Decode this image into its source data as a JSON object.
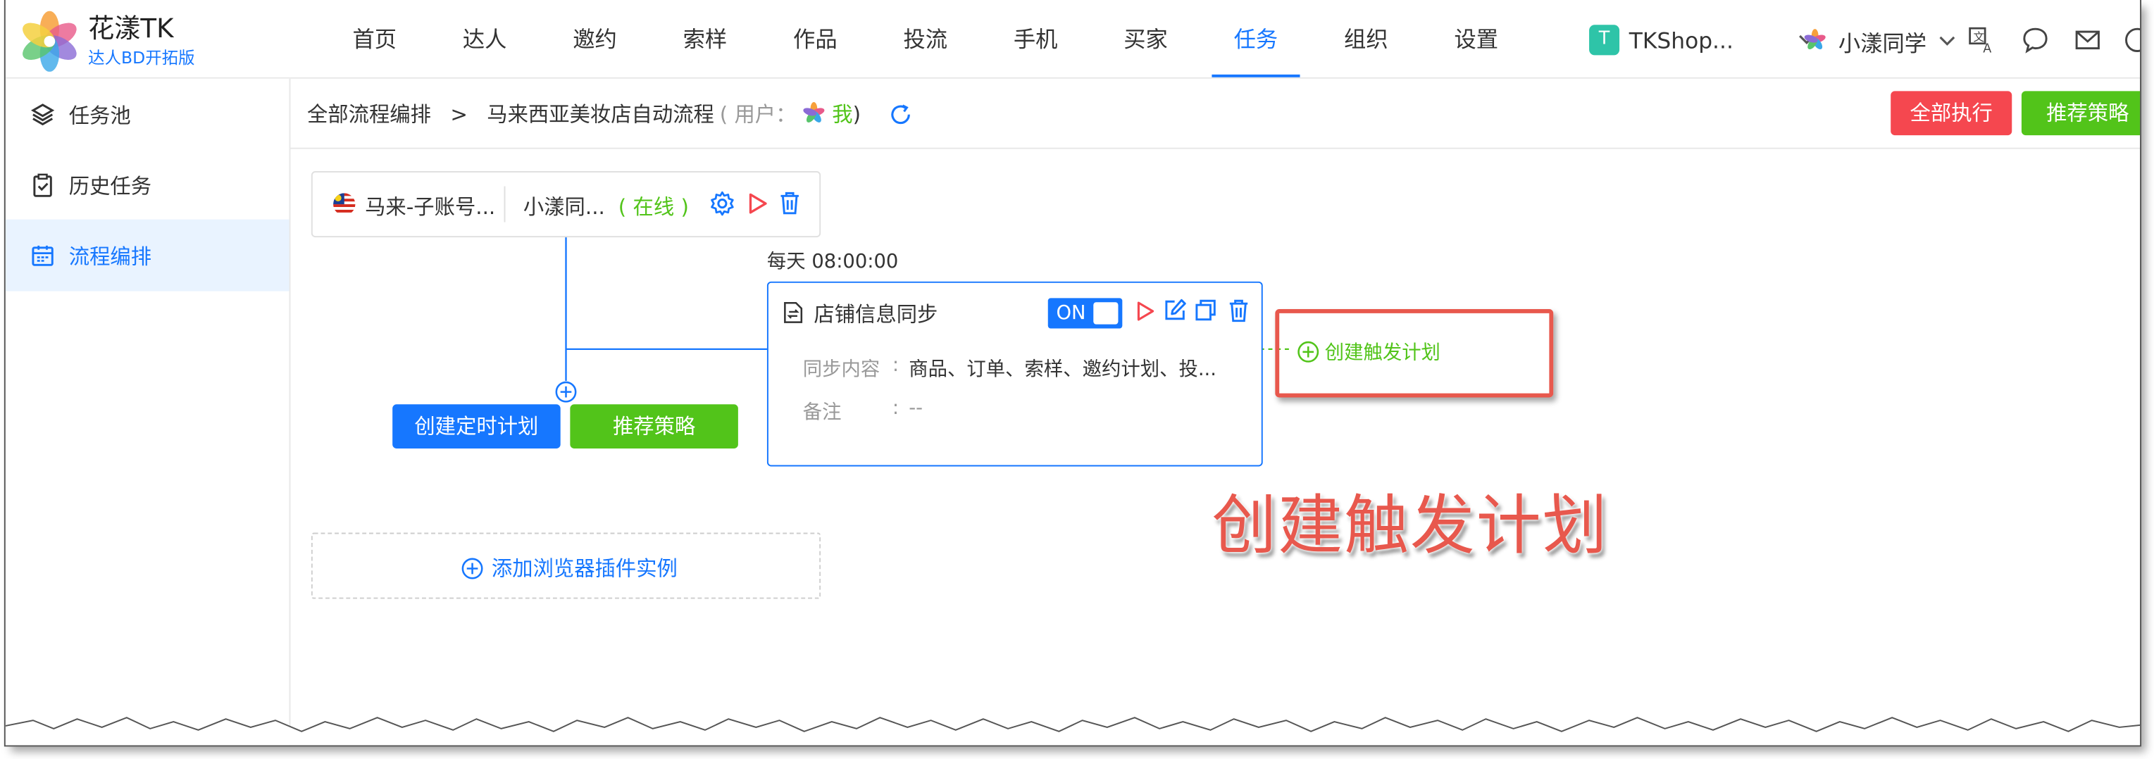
{
  "brand": {
    "title": "花漾TK",
    "subtitle": "达人BD开拓版"
  },
  "nav": {
    "items": [
      "首页",
      "达人",
      "邀约",
      "索样",
      "作品",
      "投流",
      "手机",
      "买家",
      "任务",
      "组织",
      "设置"
    ],
    "active_index": 8
  },
  "header": {
    "shop_badge": "T",
    "shop_name": "TKShop...",
    "user_name": "小漾同学"
  },
  "sidebar": {
    "items": [
      {
        "label": "任务池",
        "icon": "layers-icon"
      },
      {
        "label": "历史任务",
        "icon": "clipboard-check-icon"
      },
      {
        "label": "流程编排",
        "icon": "calendar-icon",
        "active": true
      }
    ]
  },
  "breadcrumb": {
    "root": "全部流程编排",
    "separator": ">",
    "current": "马来西亚美妆店自动流程",
    "user_prefix": "( 用户：",
    "user_value": "我",
    "user_suffix": " )"
  },
  "actions": {
    "run_all": "全部执行",
    "recommend": "推荐策略"
  },
  "account": {
    "name": "马来-子账号...",
    "user": "小漾同...",
    "status": "( 在线 )"
  },
  "schedule": {
    "create_timer": "创建定时计划",
    "recommend": "推荐策略"
  },
  "task": {
    "time": "每天  08:00:00",
    "title": "店铺信息同步",
    "toggle": "ON",
    "sync_label": "同步内容",
    "sync_value": "商品、订单、索样、邀约计划、投...",
    "note_label": "备注",
    "note_value": "--",
    "colon": ":"
  },
  "trigger": {
    "label": "创建触发计划"
  },
  "callout": {
    "text": "创建触发计划"
  },
  "add_plugin": {
    "label": "添加浏览器插件实例"
  },
  "colors": {
    "primary": "#1677ff",
    "success": "#52c41a",
    "danger": "#f5474f",
    "annotation": "#e8584d"
  }
}
